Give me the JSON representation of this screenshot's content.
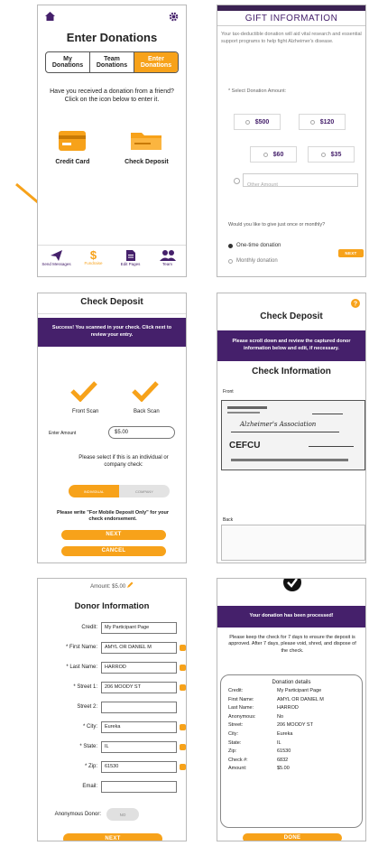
{
  "screen1": {
    "title": "Enter Donations",
    "segments": [
      {
        "line1": "My",
        "line2": "Donations"
      },
      {
        "line1": "Team",
        "line2": "Donations"
      },
      {
        "line1": "Enter",
        "line2": "Donations"
      }
    ],
    "prompt": "Have you received a donation from a friend? Click on the icon below to enter it.",
    "options": [
      "Credit Card",
      "Check Deposit"
    ],
    "tabs": [
      "Send Messages",
      "Fundraise",
      "Edit Pages",
      "Team"
    ],
    "colors": {
      "accent": "#f7a21a",
      "brand": "#45206b"
    }
  },
  "screen2": {
    "header": "GIFT INFORMATION",
    "intro": "Your tax-deductible donation will aid vital research and essential support programs to help fight Alzheimer's disease.",
    "select_label": "* Select Donation Amount:",
    "amounts": [
      "$500",
      "$120",
      "$60",
      "$35"
    ],
    "other_placeholder": "Other Amount",
    "frequency_question": "Would you like to give just once or monthly?",
    "frequency_options": [
      "One-time donation",
      "Monthly donation"
    ],
    "next_label": "NEXT"
  },
  "screen3": {
    "title": "Check Deposit",
    "banner": "Success! You scanned in your check. Click next to review your entry.",
    "scans": [
      "Front Scan",
      "Back Scan"
    ],
    "amount_label": "Enter Amount",
    "amount_value": "$5.00",
    "select_type": "Please select if this is an individual or company check:",
    "toggle": [
      "INDIVIDUAL",
      "COMPANY"
    ],
    "endorsement": "Please write \"For Mobile Deposit Only\" for your check endorsement.",
    "next_label": "NEXT",
    "cancel_label": "CANCEL"
  },
  "screen4": {
    "title": "Check Deposit",
    "banner": "Please scroll down and review the captured donor information below and edit, if necessary.",
    "section": "Check Information",
    "front_label": "Front",
    "back_label": "Back",
    "check_bank": "CEFCU",
    "check_payee": "Alzheimer's Association"
  },
  "screen5": {
    "amount_line": "Amount: $5.00",
    "title": "Donor Information",
    "fields": [
      {
        "label": "Credit:",
        "value": "My Participant Page",
        "edit": false
      },
      {
        "label": "* First Name:",
        "value": "AMYL OR DANIEL M",
        "edit": true
      },
      {
        "label": "* Last Name:",
        "value": "HARROD",
        "edit": true
      },
      {
        "label": "* Street 1:",
        "value": "206 MOODY ST",
        "edit": true
      },
      {
        "label": "Street 2:",
        "value": "",
        "edit": false
      },
      {
        "label": "* City:",
        "value": "Eureka",
        "edit": true
      },
      {
        "label": "* State:",
        "value": "IL",
        "edit": true
      },
      {
        "label": "* Zip:",
        "value": "61530",
        "edit": true
      },
      {
        "label": "Email:",
        "value": "",
        "edit": false
      }
    ],
    "anon_label": "Anonymous Donor:",
    "anon_toggle": "NO",
    "next_label": "NEXT"
  },
  "screen6": {
    "banner": "Your donation has been processed!",
    "message": "Please keep the check for 7 days to ensure the deposit is approved. After 7 days, please void, shred, and dispose of the check.",
    "details_title": "Donation details",
    "details": [
      {
        "k": "Credit:",
        "v": "My Participant Page"
      },
      {
        "k": "First Name:",
        "v": "AMYL OR DANIEL M"
      },
      {
        "k": "Last Name:",
        "v": "HARROD"
      },
      {
        "k": "Anonymous:",
        "v": "No"
      },
      {
        "k": "Street:",
        "v": "206 MOODY ST"
      },
      {
        "k": "City:",
        "v": "Eureka"
      },
      {
        "k": "State:",
        "v": "IL"
      },
      {
        "k": "Zip:",
        "v": "61530"
      },
      {
        "k": "Check #:",
        "v": "6832"
      },
      {
        "k": "Amount:",
        "v": "$5.00"
      }
    ],
    "done_label": "DONE"
  }
}
